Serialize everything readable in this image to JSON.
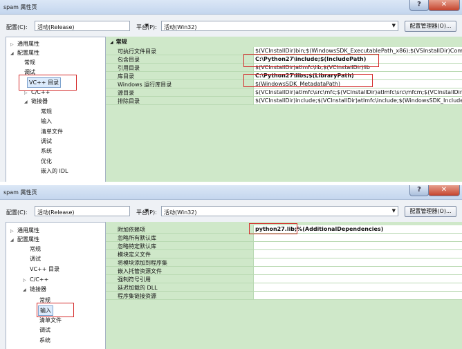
{
  "window1": {
    "title": "spam 属性页",
    "help": "?",
    "close": "✕",
    "config_label": "配置(C):",
    "config_value": "活动(Release)",
    "platform_label": "平台(P):",
    "platform_value": "活动(Win32)",
    "config_manager": "配置管理器(O)...",
    "tree": [
      {
        "label": "通用属性",
        "twisty": "▷"
      },
      {
        "label": "配置属性",
        "twisty": "◢"
      },
      {
        "label": "常规",
        "twisty": ""
      },
      {
        "label": "调试",
        "twisty": ""
      },
      {
        "label": "VC++ 目录",
        "twisty": ""
      },
      {
        "label": "C/C++",
        "twisty": "▷"
      },
      {
        "label": "链接器",
        "twisty": "◢"
      },
      {
        "label": "常规",
        "twisty": ""
      },
      {
        "label": "输入",
        "twisty": ""
      },
      {
        "label": "清单文件",
        "twisty": ""
      },
      {
        "label": "调试",
        "twisty": ""
      },
      {
        "label": "系统",
        "twisty": ""
      },
      {
        "label": "优化",
        "twisty": ""
      },
      {
        "label": "嵌入的 IDL",
        "twisty": ""
      }
    ],
    "group": "常规",
    "group_twisty": "◢",
    "rows": [
      {
        "name": "可执行文件目录",
        "value": "$(VCInstallDir)bin;$(WindowsSDK_ExecutablePath_x86);$(VSInstallDir)Common7\\Tools\\bin;$(VSInstallDir)C"
      },
      {
        "name": "包含目录",
        "value": "C:\\Python27\\include;$(IncludePath)"
      },
      {
        "name": "引用目录",
        "value": "$(VCInstallDir)atlmfc\\lib;$(VCInstallDir)lib"
      },
      {
        "name": "库目录",
        "value": "C:\\Python27\\libs;$(LibraryPath)"
      },
      {
        "name": "Windows 运行库目录",
        "value": "$(WindowsSDK_MetadataPath)"
      },
      {
        "name": "源目录",
        "value": "$(VCInstallDir)atlmfc\\src\\mfc;$(VCInstallDir)atlmfc\\src\\mfcm;$(VCInstallDir)atlmfc\\src\\atl"
      },
      {
        "name": "排除目录",
        "value": "$(VCInstallDir)include;$(VCInstallDir)atlmfc\\include;$(WindowsSDK_IncludePath)"
      }
    ]
  },
  "window2": {
    "title": "spam 属性页",
    "help": "?",
    "close": "✕",
    "config_label": "配置(C):",
    "config_value": "活动(Release)",
    "platform_label": "平台(P):",
    "platform_value": "活动(Win32)",
    "config_manager": "配置管理器(O)...",
    "tree": [
      {
        "label": "通用属性",
        "twisty": "▷"
      },
      {
        "label": "配置属性",
        "twisty": "◢"
      },
      {
        "label": "常规",
        "twisty": ""
      },
      {
        "label": "调试",
        "twisty": ""
      },
      {
        "label": "VC++ 目录",
        "twisty": ""
      },
      {
        "label": "C/C++",
        "twisty": "▷"
      },
      {
        "label": "链接器",
        "twisty": "◢"
      },
      {
        "label": "常规",
        "twisty": ""
      },
      {
        "label": "输入",
        "twisty": ""
      },
      {
        "label": "清单文件",
        "twisty": ""
      },
      {
        "label": "调试",
        "twisty": ""
      },
      {
        "label": "系统",
        "twisty": ""
      }
    ],
    "rows": [
      {
        "name": "附加依赖项",
        "value": "python27.lib;%(AdditionalDependencies)"
      },
      {
        "name": "忽略所有默认库",
        "value": ""
      },
      {
        "name": "忽略特定默认库",
        "value": ""
      },
      {
        "name": "模块定义文件",
        "value": ""
      },
      {
        "name": "将模块添加到程序集",
        "value": ""
      },
      {
        "name": "嵌入托管资源文件",
        "value": ""
      },
      {
        "name": "强制符号引用",
        "value": ""
      },
      {
        "name": "延迟加载的 DLL",
        "value": ""
      },
      {
        "name": "程序集链接资源",
        "value": ""
      }
    ]
  }
}
